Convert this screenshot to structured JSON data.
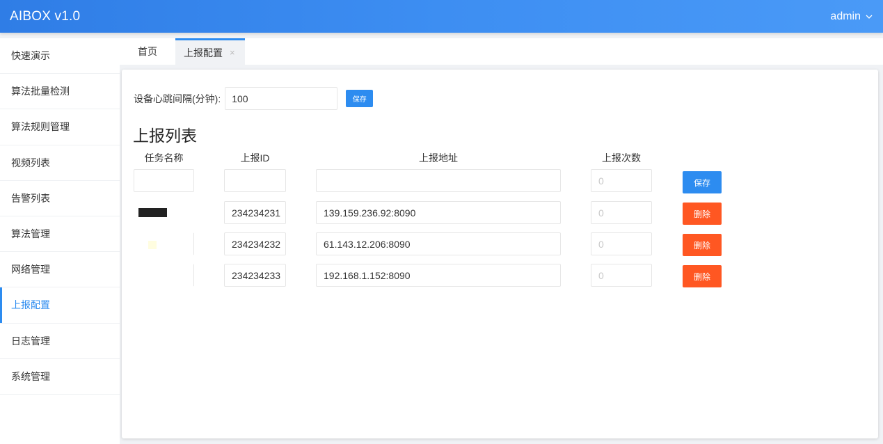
{
  "app": {
    "title": "AIBOX v1.0",
    "user": "admin"
  },
  "sidebar": {
    "items": [
      {
        "label": "快速演示"
      },
      {
        "label": "算法批量检测"
      },
      {
        "label": "算法规则管理"
      },
      {
        "label": "视频列表"
      },
      {
        "label": "告警列表"
      },
      {
        "label": "算法管理"
      },
      {
        "label": "网络管理"
      },
      {
        "label": "上报配置",
        "active": true
      },
      {
        "label": "日志管理"
      },
      {
        "label": "系统管理"
      }
    ]
  },
  "tabs": [
    {
      "label": "首页"
    },
    {
      "label": "上报配置",
      "active": true,
      "close": "×"
    }
  ],
  "heartbeat": {
    "label": "设备心跳间隔(分钟):",
    "value": "100",
    "save_label": "保存"
  },
  "report_list": {
    "title": "上报列表",
    "columns": [
      "任务名称",
      "上报ID",
      "上报地址",
      "上报次数"
    ],
    "new_row": {
      "name": "",
      "id": "",
      "address": "",
      "count_placeholder": "0",
      "action_label": "保存"
    },
    "rows": [
      {
        "name": "",
        "id": "234234231",
        "address": "139.159.236.92:8090",
        "count": "0",
        "action_label": "删除"
      },
      {
        "name": "",
        "id": "234234232",
        "address": "61.143.12.206:8090",
        "count": "0",
        "action_label": "删除"
      },
      {
        "name": "",
        "id": "234234233",
        "address": "192.168.1.152:8090",
        "count": "0",
        "action_label": "删除"
      }
    ]
  },
  "colors": {
    "primary": "#2d8cf0",
    "danger": "#ff5722",
    "header_start": "#2f7de6",
    "header_end": "#4a9af7"
  },
  "icons": {
    "user_menu": "chevron-down-icon",
    "tab_close": "close-icon"
  }
}
